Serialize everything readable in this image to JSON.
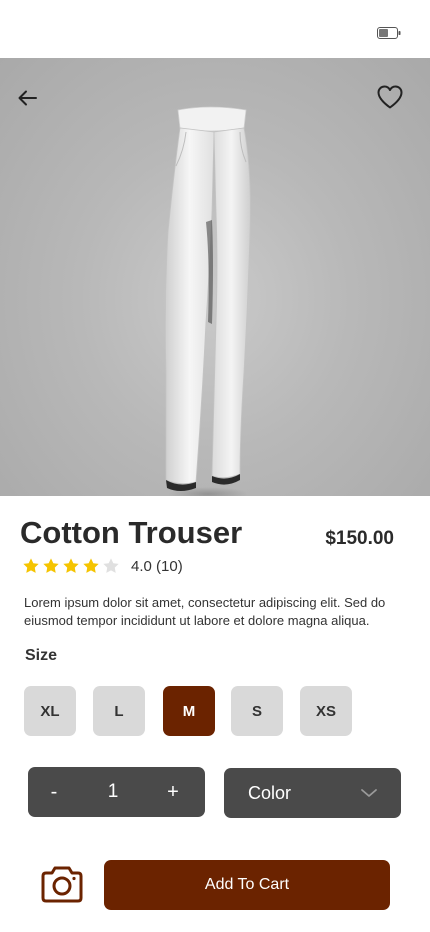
{
  "status_bar": {
    "battery_icon": "battery-icon"
  },
  "nav": {
    "back_icon": "arrow-left-icon",
    "favorite_icon": "heart-icon"
  },
  "product": {
    "title": "Cotton Trouser",
    "price": "$150.00",
    "rating": 4,
    "rating_text": "4.0 (10)",
    "description": "Lorem ipsum dolor sit amet, consectetur adipiscing elit. Sed do eiusmod tempor incididunt ut labore et dolore magna aliqua."
  },
  "size": {
    "label": "Size",
    "options": [
      "XL",
      "L",
      "M",
      "S",
      "XS"
    ],
    "selected": "M"
  },
  "quantity": {
    "minus": "-",
    "value": "1",
    "plus": "+"
  },
  "color_select": {
    "label": "Color"
  },
  "actions": {
    "camera_icon": "camera-icon",
    "add_to_cart": "Add To Cart"
  },
  "colors": {
    "accent": "#6b2300",
    "control_bg": "#4a4a4a",
    "size_bg": "#d9d9d9",
    "star": "#f5c400",
    "star_empty": "#e0e0e0"
  }
}
